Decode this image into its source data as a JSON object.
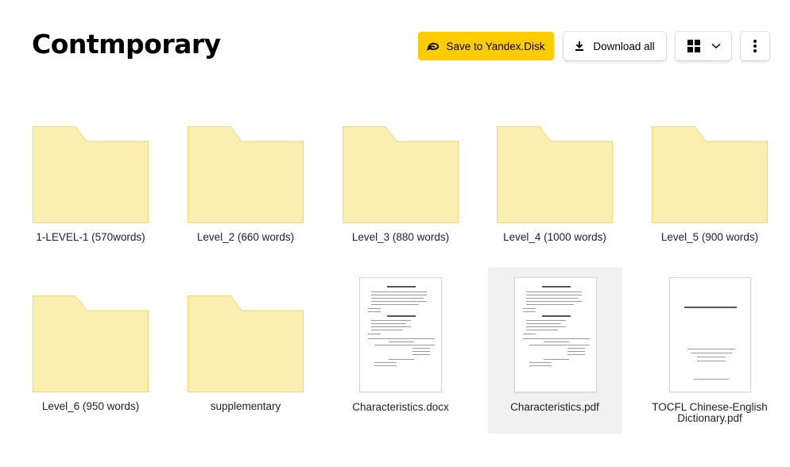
{
  "page": {
    "title": "Contmporary"
  },
  "toolbar": {
    "save_label": "Save to Yandex.Disk",
    "save_icon": "yandex-disk-icon",
    "download_label": "Download all",
    "download_icon": "download-icon",
    "view_icon": "grid-view-icon",
    "view_dropdown_icon": "chevron-down-icon",
    "more_icon": "more-vertical-icon",
    "accent_color": "#ffcc00"
  },
  "items": [
    {
      "type": "folder",
      "name": "1-LEVEL-1 (570words)"
    },
    {
      "type": "folder",
      "name": "Level_2 (660 words)"
    },
    {
      "type": "folder",
      "name": "Level_3 (880 words)"
    },
    {
      "type": "folder",
      "name": "Level_4 (1000 words)"
    },
    {
      "type": "folder",
      "name": "Level_5 (900 words)"
    },
    {
      "type": "folder",
      "name": "Level_6 (950 words)"
    },
    {
      "type": "folder",
      "name": "supplementary"
    },
    {
      "type": "file",
      "name": "Characteristics.docx"
    },
    {
      "type": "file",
      "name": "Characteristics.pdf",
      "selected": true
    },
    {
      "type": "file",
      "name": "TOCFL Chinese-English Dictionary.pdf",
      "display_lines": [
        "TOCFL Chinese-English",
        "Dictionary.pdf"
      ]
    }
  ],
  "folder_colors": {
    "fill": "#fbeeb1",
    "stroke": "#efd77a"
  }
}
